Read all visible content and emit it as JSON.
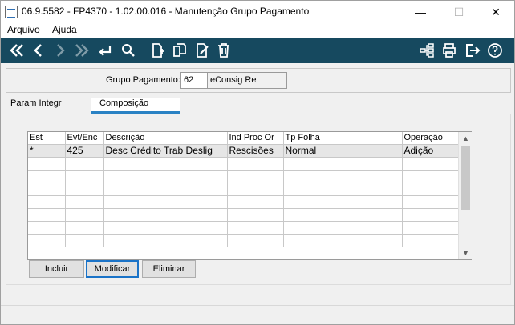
{
  "window": {
    "title": "06.9.5582 - FP4370 - 1.02.00.016 - Manutenção Grupo Pagamento",
    "min": "—",
    "max": "☐",
    "close": "✕"
  },
  "menu": {
    "items": [
      {
        "label": "rquivo",
        "accel": "A"
      },
      {
        "label": "juda",
        "accel": "A"
      }
    ]
  },
  "toolbar": {
    "icons": [
      "first-record-icon",
      "previous-record-icon",
      "next-record-icon",
      "last-record-icon",
      "return-icon",
      "search-icon",
      "new-document-icon",
      "copy-document-icon",
      "edit-document-icon",
      "delete-icon",
      "tree-structure-icon",
      "print-icon",
      "exit-icon",
      "help-icon"
    ]
  },
  "header": {
    "label": "Grupo Pagamento:",
    "code": "62",
    "description": "eConsig Re"
  },
  "tabs": [
    {
      "label": "Param Integr"
    },
    {
      "label": "Composição",
      "active": true
    }
  ],
  "grid": {
    "columns": [
      "Est",
      "Evt/Enc",
      "Descrição",
      "Ind Proc Or",
      "Tp Folha",
      "Operação"
    ],
    "rows": [
      [
        "*",
        "425",
        "Desc Crédito Trab Deslig",
        "Rescisões",
        "Normal",
        "Adição"
      ],
      [
        "",
        "",
        "",
        "",
        "",
        ""
      ],
      [
        "",
        "",
        "",
        "",
        "",
        ""
      ],
      [
        "",
        "",
        "",
        "",
        "",
        ""
      ],
      [
        "",
        "",
        "",
        "",
        "",
        ""
      ],
      [
        "",
        "",
        "",
        "",
        "",
        ""
      ],
      [
        "",
        "",
        "",
        "",
        "",
        ""
      ],
      [
        "",
        "",
        "",
        "",
        "",
        ""
      ]
    ]
  },
  "buttons": {
    "incluir": "Incluir",
    "modificar": "Modificar",
    "eliminar": "Eliminar"
  },
  "colors": {
    "toolbar": "#16495f",
    "tab_underline": "#2a82c4",
    "focus_border": "#1a73c8"
  }
}
